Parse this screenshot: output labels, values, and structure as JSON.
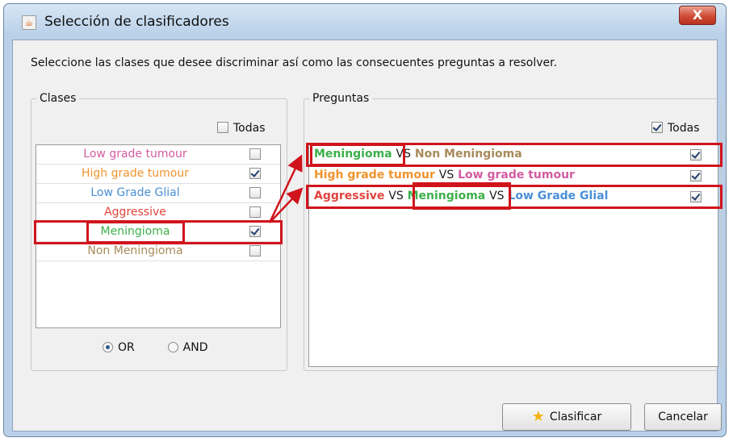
{
  "window": {
    "title": "Selección de clasificadores",
    "close_label": "X",
    "icon": "java-icon"
  },
  "instructions": "Seleccione las clases que desee discriminar así como las consecuentes preguntas a resolver.",
  "clases": {
    "title": "Clases",
    "todas_label": "Todas",
    "todas_checked": false,
    "items": [
      {
        "label": "Low grade tumour",
        "color": "#d25ca0",
        "checked": false
      },
      {
        "label": "High grade tumour",
        "color": "#f0942e",
        "checked": true
      },
      {
        "label": "Low Grade Glial",
        "color": "#4a8fd8",
        "checked": false
      },
      {
        "label": "Aggressive",
        "color": "#e0443c",
        "checked": false
      },
      {
        "label": "Meningioma",
        "color": "#3cb04a",
        "checked": true
      },
      {
        "label": "Non Meningioma",
        "color": "#a88a5a",
        "checked": false
      }
    ],
    "radio_or": "OR",
    "radio_and": "AND",
    "selected_radio": "OR"
  },
  "preguntas": {
    "title": "Preguntas",
    "todas_label": "Todas",
    "todas_checked": true,
    "vs_label": "VS",
    "rows": [
      {
        "parts": [
          {
            "text": "Meningioma",
            "color": "#3cb04a"
          },
          {
            "text": "Non Meningioma",
            "color": "#a88a5a"
          }
        ],
        "checked": true
      },
      {
        "parts": [
          {
            "text": "High grade tumour",
            "color": "#f0942e"
          },
          {
            "text": "Low grade tumour",
            "color": "#d25ca0"
          }
        ],
        "checked": true
      },
      {
        "parts": [
          {
            "text": "Aggressive",
            "color": "#e0443c"
          },
          {
            "text": "Meningioma",
            "color": "#3cb04a"
          },
          {
            "text": "Low Grade Glial",
            "color": "#4a8fd8"
          }
        ],
        "checked": true
      }
    ]
  },
  "buttons": {
    "clasificar": "Clasificar",
    "cancelar": "Cancelar"
  },
  "annotation_color": "#d0141c"
}
